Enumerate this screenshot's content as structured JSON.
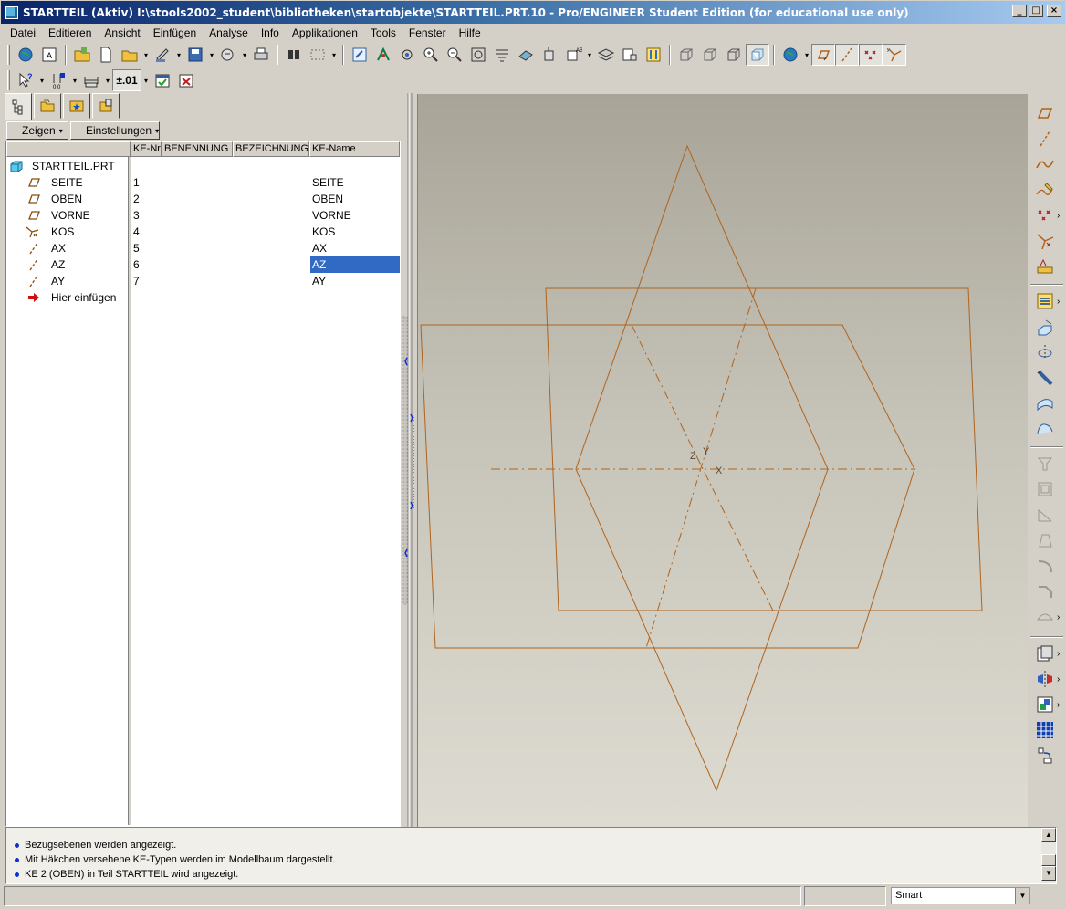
{
  "window": {
    "title": "STARTTEIL (Aktiv) I:\\stools2002_student\\bibliotheken\\startobjekte\\STARTTEIL.PRT.10 - Pro/ENGINEER Student Edition (for educational use only)",
    "min": "_",
    "max": "□",
    "close": "×"
  },
  "menu": [
    "Datei",
    "Editieren",
    "Ansicht",
    "Einfügen",
    "Analyse",
    "Info",
    "Applikationen",
    "Tools",
    "Fenster",
    "Hilfe"
  ],
  "toolbar2": {
    "tolerance_label": "±.01"
  },
  "panel": {
    "show_button": "Zeigen",
    "settings_button": "Einstellungen",
    "columns": [
      "KE-Nr.",
      "BENENNUNG",
      "BEZEICHNUNG",
      "KE-Name"
    ],
    "root": "STARTTEIL.PRT",
    "rows": [
      {
        "name": "SEITE",
        "nr": "1",
        "ke": "SEITE",
        "icon": "datum-plane-icon"
      },
      {
        "name": "OBEN",
        "nr": "2",
        "ke": "OBEN",
        "icon": "datum-plane-icon"
      },
      {
        "name": "VORNE",
        "nr": "3",
        "ke": "VORNE",
        "icon": "datum-plane-icon"
      },
      {
        "name": "KOS",
        "nr": "4",
        "ke": "KOS",
        "icon": "coordinate-system-icon"
      },
      {
        "name": "AX",
        "nr": "5",
        "ke": "AX",
        "icon": "datum-axis-icon"
      },
      {
        "name": "AZ",
        "nr": "6",
        "ke": "AZ",
        "icon": "datum-axis-icon",
        "selected": true
      },
      {
        "name": "AY",
        "nr": "7",
        "ke": "AY",
        "icon": "datum-axis-icon"
      }
    ],
    "insert_here": "Hier einfügen"
  },
  "viewport": {
    "axis_labels": [
      "Z",
      "Y",
      "X"
    ],
    "datum_color": "#b0641e"
  },
  "messages": [
    "Bezugsebenen werden angezeigt.",
    "Mit Häkchen versehene KE-Typen werden im Modellbaum dargestellt.",
    "KE 2 (OBEN) in Teil STARTTEIL wird angezeigt."
  ],
  "status": {
    "filter_value": "Smart"
  }
}
